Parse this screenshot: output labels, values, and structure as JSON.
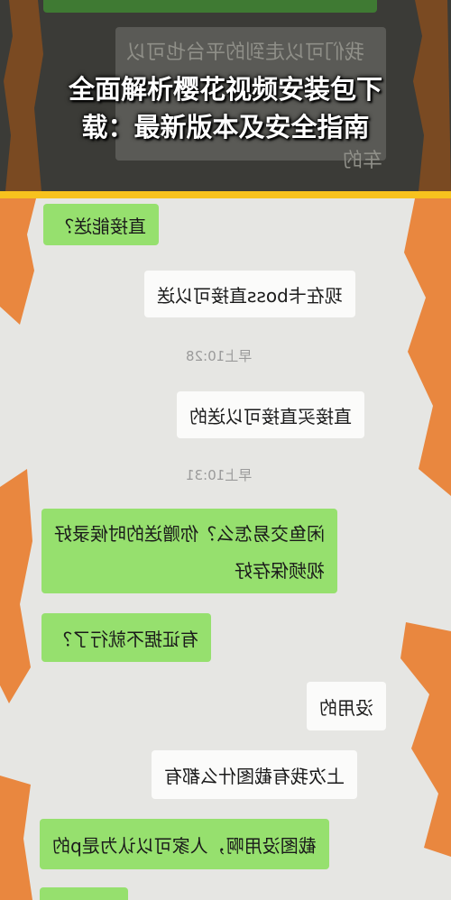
{
  "headline": {
    "line1": "全面解析樱花视频安装包下",
    "line2": "载：最新版本及安全指南"
  },
  "background_text": {
    "line1": "我们可以走到的平台也可以",
    "line2": "车的"
  },
  "messages": [
    {
      "side": "left",
      "text": "直接能送？"
    },
    {
      "side": "right",
      "text": "现在卡boss直接可以送"
    },
    {
      "time": "早上10:28"
    },
    {
      "side": "right",
      "text": "直接买直接可以送的"
    },
    {
      "time": "早上10:31"
    },
    {
      "side": "left",
      "text": "闲鱼交易怎么？你赠送的时候录好"
    },
    {
      "side": "left",
      "text": "视频保存好"
    },
    {
      "side": "left",
      "text": "有证据不就行了？"
    },
    {
      "side": "right",
      "text": "没用的"
    },
    {
      "side": "right",
      "text": "上次我有截图什么都有"
    },
    {
      "side": "left",
      "text": "截图没用啊，人家可以认为是p的"
    }
  ],
  "colors": {
    "header_bg": "#3b3b37",
    "accent_bar": "#f7c21e",
    "bubble_green": "#96e06e",
    "bubble_white": "#fbfbfa",
    "scribble_orange": "#e9873f",
    "scribble_brown": "#7a4a22"
  }
}
